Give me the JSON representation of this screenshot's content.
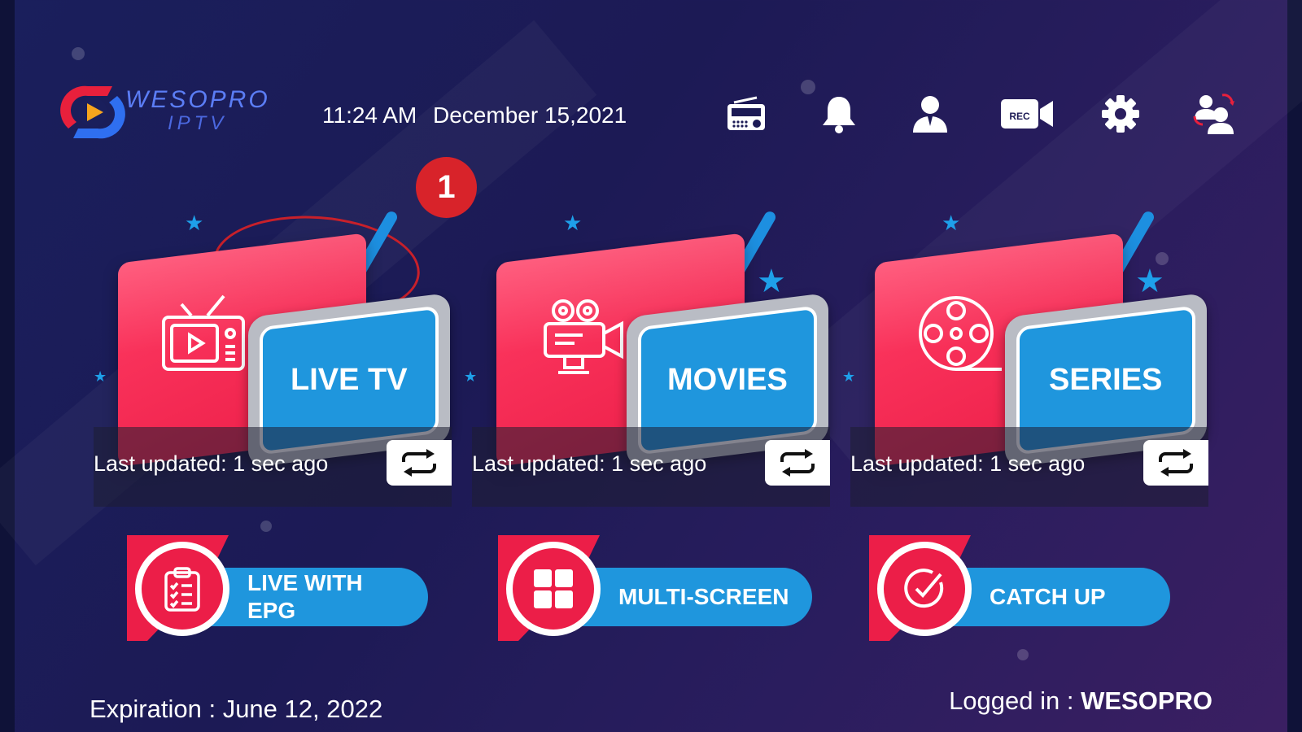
{
  "header": {
    "brand_line1": "WESOPRO",
    "brand_line2": "IPTV",
    "time": "11:24 AM",
    "date": "December 15,2021",
    "icons": [
      "radio-icon",
      "bell-icon",
      "user-icon",
      "rec-camera-icon",
      "gear-icon",
      "switch-user-icon"
    ],
    "rec_text": "REC"
  },
  "annotation": {
    "badge": "1"
  },
  "cards": [
    {
      "label": "LIVE TV",
      "updated": "Last updated: 1 sec ago",
      "icon": "tv-icon"
    },
    {
      "label": "MOVIES",
      "updated": "Last updated: 1 sec ago",
      "icon": "movie-camera-icon"
    },
    {
      "label": "SERIES",
      "updated": "Last updated: 1 sec ago",
      "icon": "film-reel-icon"
    }
  ],
  "pills": [
    {
      "label": "LIVE WITH\nEPG",
      "icon": "clipboard-icon"
    },
    {
      "label": "MULTI-SCREEN",
      "icon": "grid-icon"
    },
    {
      "label": "CATCH UP",
      "icon": "check-circle-icon"
    }
  ],
  "footer": {
    "expiration": "Expiration : June 12, 2022",
    "logged_label": "Logged in : ",
    "logged_user": "WESOPRO"
  },
  "colors": {
    "accent_red": "#ec1e48",
    "accent_blue": "#1f96dd",
    "background": "#1c1a55"
  }
}
